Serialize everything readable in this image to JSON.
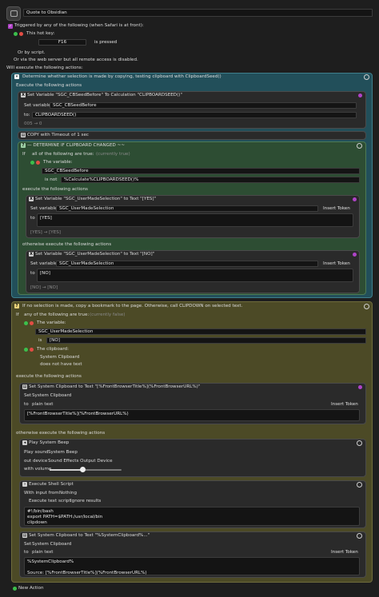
{
  "macro": {
    "icon": "macro-icon",
    "name": "Quote to Obsidian"
  },
  "trigger": {
    "header": "Triggered by any of the following (when Safari is at front):",
    "hotkey_label": "This hot key:",
    "hotkey_value": "F16",
    "hotkey_mode": "is pressed",
    "or_script": "Or by script.",
    "or_web": "Or via the web server but all remote access is disabled.",
    "will_execute": "Will execute the following actions:"
  },
  "group1": {
    "title": "Determine whether selection is made by copying, testing clipboard with ClipboardSeed()",
    "execute": "Execute the following actions",
    "a1": {
      "title": "Set Variable \"SGC_CBSeedBefore\" To Calculation \"CLIPBOARDSEED()\"",
      "set_label": "Set variable",
      "var": "SGC_CBSeedBefore",
      "to_label": "to:",
      "value": "CLIPBOARDSEED()",
      "preview": "005 → 0"
    },
    "a2": {
      "title": "COPY with Timeout of 1 sec"
    },
    "a3": {
      "title": "— DETERMINE IF CLIPBOARD CHANGED ~~",
      "if_all": "all of the following are true:",
      "status": "(currently true)",
      "the_variable": "The variable:",
      "var": "SGC_CBSeedBefore",
      "op": "is not",
      "value": "%Calculate%CLIPBOARDSEED()%",
      "execute": "execute the following actions",
      "yes": {
        "title": "Set Variable \"SGC_UserMadeSelection\" to Text \"[YES]\"",
        "set_label": "Set variable",
        "var": "SGC_UserMadeSelection",
        "insert": "Insert Token",
        "to_label": "to",
        "value": "[YES]",
        "preview": "[YES] → [YES]"
      },
      "otherwise": "otherwise execute the following actions",
      "no": {
        "title": "Set Variable \"SGC_UserMadeSelection\" to Text \"[NO]\"",
        "set_label": "Set variable",
        "var": "SGC_UserMadeSelection",
        "insert": "Insert Token",
        "to_label": "to",
        "value": "[NO]",
        "preview": "[NO] → [NO]"
      }
    }
  },
  "group2": {
    "title": "If no selection is made, copy a bookmark to the page. Otherwise, call CLIPDOWN on selected text.",
    "if_any": "any of the following are true:",
    "status": "(currently false)",
    "the_variable": "The variable:",
    "var": "SGC_UserMadeSelection",
    "op": "is",
    "value": "[NO]",
    "the_clipboard": "The clipboard:",
    "clipboard": "System Clipboard",
    "clip_cond": "does not have text",
    "execute": "execute the following actions",
    "b1": {
      "title": "Set System Clipboard to Text \"[%FrontBrowserTitle%](%FrontBrowserURL%)\"",
      "set_label": "Set",
      "clipboard": "System Clipboard",
      "to_label": "to",
      "format": "plain text",
      "insert": "Insert Token",
      "value": "[%FrontBrowserTitle%](%FrontBrowserURL%)"
    },
    "otherwise": "otherwise execute the following actions",
    "c1": {
      "title": "Play System Beep",
      "play_label": "Play sound",
      "sound": "System Beep",
      "out_label": "out device",
      "device": "Sound Effects Output Device",
      "vol_label": "with volume",
      "volume": 0.45
    },
    "c2": {
      "title": "Execute Shell Script",
      "with_input": "With input from",
      "input": "Nothing",
      "execute": "Execute text script",
      "ignore": "Ignore results",
      "script": "#!/bin/bash\nexport PATH=$PATH:/usr/local/bin\nclipdown"
    },
    "c3": {
      "title": "Set System Clipboard to Text \"%SystemClipboard%...\"",
      "set_label": "Set",
      "clipboard": "System Clipboard",
      "to_label": "to",
      "format": "plain text",
      "insert": "Insert Token",
      "value": "%SystemClipboard%\n\nSource: [%FrontBrowserTitle%](%FrontBrowserURL%)"
    }
  },
  "new_action": "New Action",
  "colors": {
    "teal": "#224f5a",
    "olive": "#4c4a26",
    "purple": "#b043c8",
    "green": "#2d4d33"
  }
}
